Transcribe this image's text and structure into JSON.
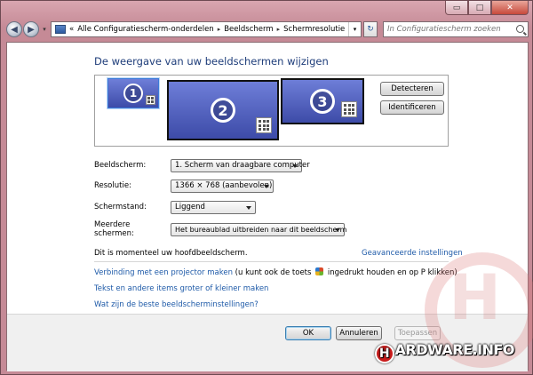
{
  "caption": {
    "minimize": "▭",
    "maximize": "□",
    "close": "✕"
  },
  "nav": {
    "back": "◀",
    "forward": "▶",
    "breadcrumb": [
      "Alle Configuratiescherm-onderdelen",
      "Beeldscherm",
      "Schermresolutie"
    ],
    "prefix": "«",
    "refresh": "↻",
    "search_placeholder": "In Configuratiescherm zoeken"
  },
  "main": {
    "title": "De weergave van uw beeldschermen wijzigen",
    "monitors": [
      {
        "number": "1",
        "selected": true
      },
      {
        "number": "2",
        "selected": false
      },
      {
        "number": "3",
        "selected": false
      }
    ],
    "detect_label": "Detecteren",
    "identify_label": "Identificeren",
    "settings": [
      {
        "label": "Beeldscherm:",
        "value": "1. Scherm van draagbare computer"
      },
      {
        "label": "Resolutie:",
        "value": "1366 × 768 (aanbevolen)"
      },
      {
        "label": "Schermstand:",
        "value": "Liggend"
      },
      {
        "label": "Meerdere schermen:",
        "value": "Het bureaublad uitbreiden naar dit beeldscherm"
      }
    ],
    "info": "Dit is momenteel uw hoofdbeeldscherm.",
    "advanced_link": "Geavanceerde instellingen",
    "projector_link": "Verbinding met een projector maken",
    "projector_hint_a": " (u kunt ook de toets ",
    "projector_hint_b": " ingedrukt houden en op P klikken)",
    "text_size_link": "Tekst en andere items groter of kleiner maken",
    "best_settings_link": "Wat zijn de beste beeldscherminstellingen?"
  },
  "footer": {
    "ok": "OK",
    "cancel": "Annuleren",
    "apply": "Toepassen"
  },
  "watermark": {
    "letter": "H",
    "logo_letter": "H",
    "logo_text": "ARDWARE.INFO"
  }
}
